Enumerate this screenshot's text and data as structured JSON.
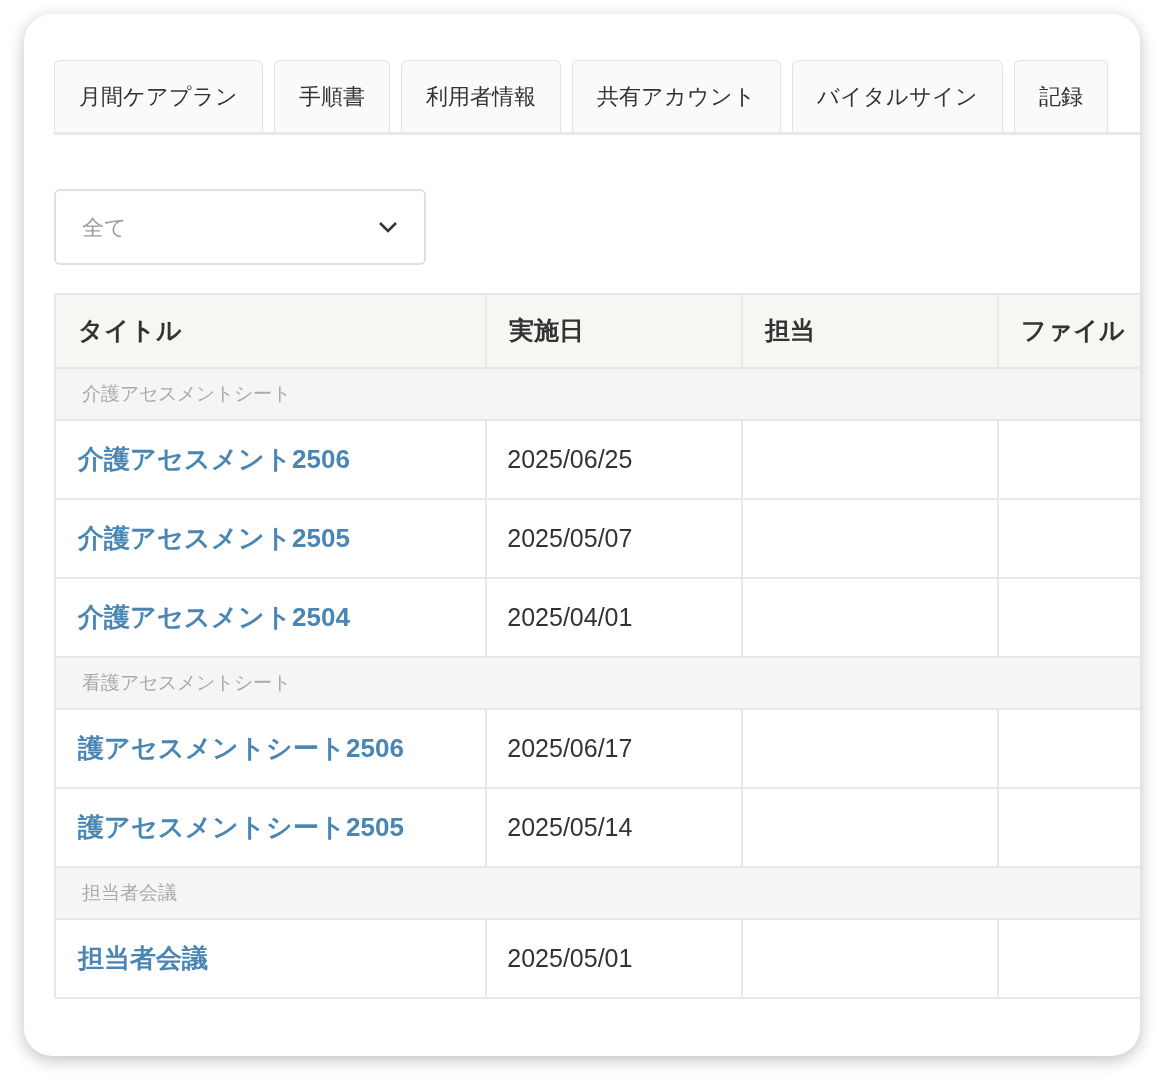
{
  "tabs": [
    {
      "label": "月間ケアプラン"
    },
    {
      "label": "手順書"
    },
    {
      "label": "利用者情報"
    },
    {
      "label": "共有アカウント"
    },
    {
      "label": "バイタルサイン"
    },
    {
      "label": "記録"
    }
  ],
  "filter": {
    "placeholder": "全て"
  },
  "table": {
    "columns": [
      "タイトル",
      "実施日",
      "担当",
      "ファイル"
    ],
    "groups": [
      {
        "name": "介護アセスメントシート",
        "rows": [
          {
            "title": "介護アセスメント2506",
            "date": "2025/06/25"
          },
          {
            "title": "介護アセスメント2505",
            "date": "2025/05/07"
          },
          {
            "title": "介護アセスメント2504",
            "date": "2025/04/01"
          }
        ]
      },
      {
        "name": "看護アセスメントシート",
        "rows": [
          {
            "title": "護アセスメントシート2506",
            "date": "2025/06/17"
          },
          {
            "title": "護アセスメントシート2505",
            "date": "2025/05/14"
          }
        ]
      },
      {
        "name": "担当者会議",
        "rows": [
          {
            "title": "担当者会議",
            "date": "2025/05/01"
          }
        ]
      }
    ]
  }
}
